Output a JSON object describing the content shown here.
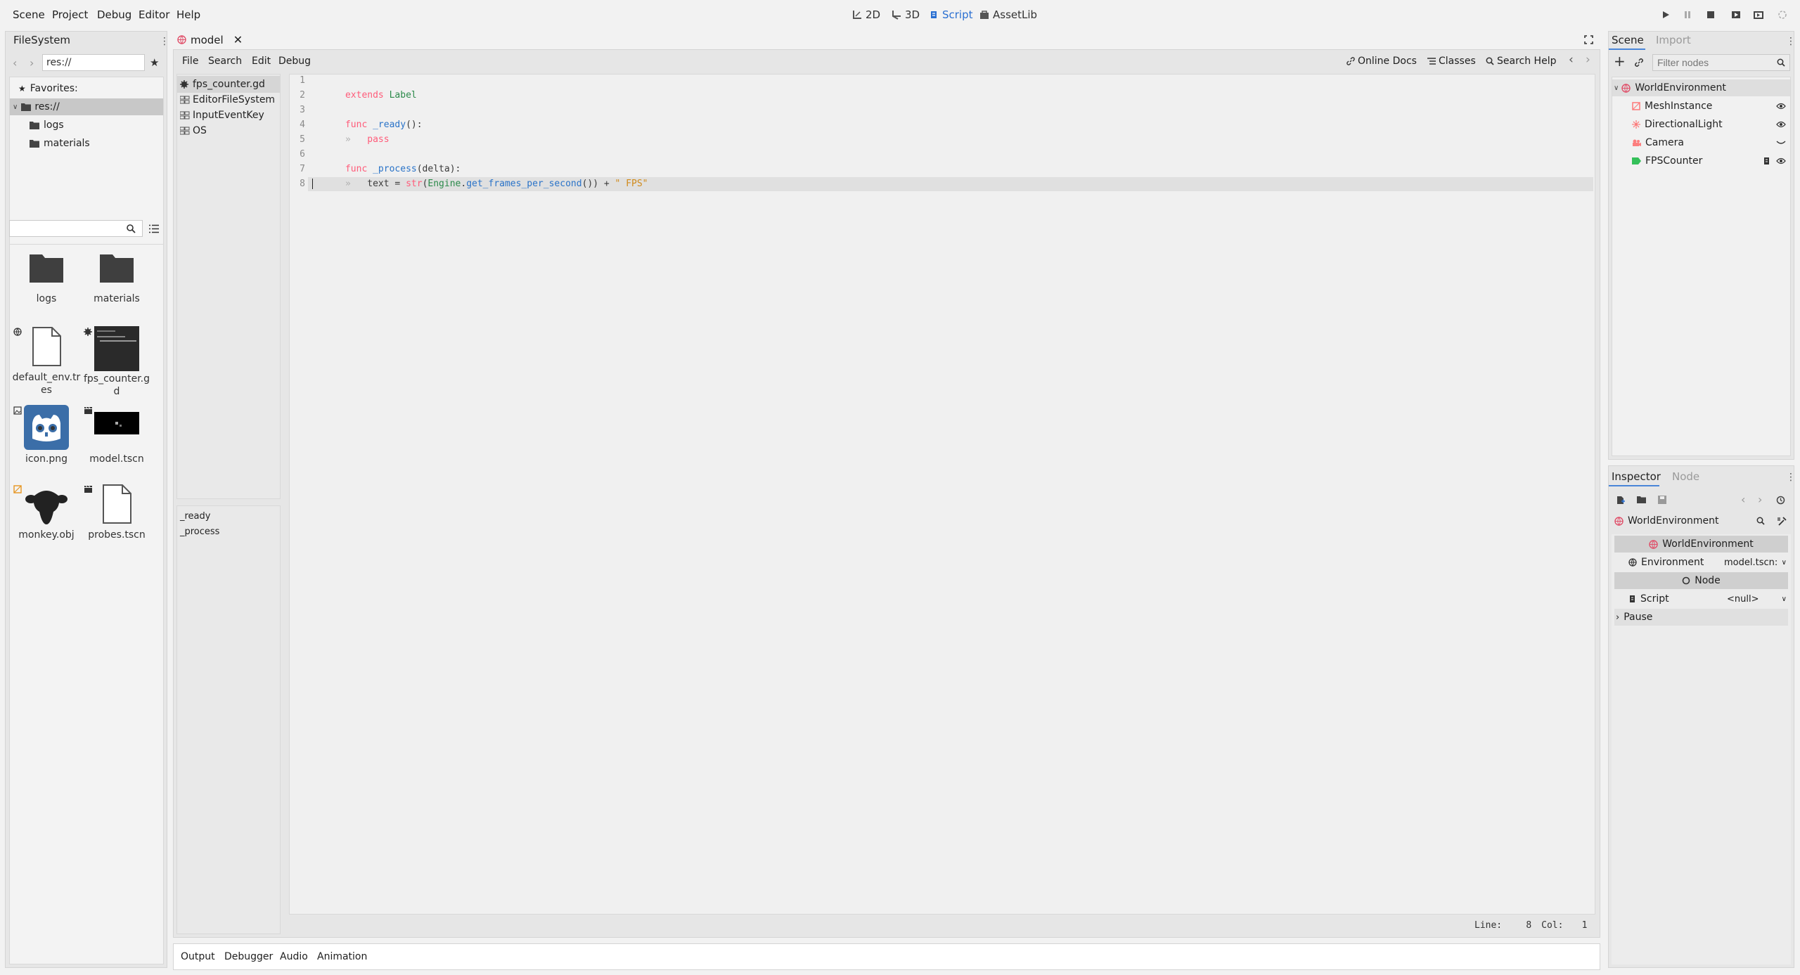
{
  "menu": [
    "Scene",
    "Project",
    "Debug",
    "Editor",
    "Help"
  ],
  "modes": [
    {
      "label": "2D",
      "icon": "2d-icon",
      "active": false
    },
    {
      "label": "3D",
      "icon": "3d-icon",
      "active": false
    },
    {
      "label": "Script",
      "icon": "script-icon",
      "active": true
    },
    {
      "label": "AssetLib",
      "icon": "assetlib-icon",
      "active": false
    }
  ],
  "filesystem": {
    "tab": "FileSystem",
    "path": "res://",
    "favorites": "Favorites:",
    "tree": [
      "res://",
      "logs",
      "materials"
    ],
    "search_placeholder": "",
    "files": [
      {
        "name": "logs",
        "type": "folder"
      },
      {
        "name": "materials",
        "type": "folder"
      },
      {
        "name": "default_env.tres",
        "type": "resource"
      },
      {
        "name": "fps_counter.gd",
        "type": "script"
      },
      {
        "name": "icon.png",
        "type": "image"
      },
      {
        "name": "model.tscn",
        "type": "scene"
      },
      {
        "name": "monkey.obj",
        "type": "mesh"
      },
      {
        "name": "probes.tscn",
        "type": "scene"
      }
    ]
  },
  "scene_tab": {
    "label": "model"
  },
  "script_editor": {
    "menu": [
      "File",
      "Search",
      "Edit",
      "Debug"
    ],
    "help_buttons": [
      "Online Docs",
      "Classes",
      "Search Help"
    ],
    "scripts": [
      "fps_counter.gd",
      "EditorFileSystem",
      "InputEventKey",
      "OS"
    ],
    "methods": [
      "_ready",
      "_process"
    ],
    "line_numbers": [
      "1",
      "2",
      "3",
      "4",
      "5",
      "6",
      "7",
      "8"
    ],
    "code": {
      "l1a": "extends",
      "l1b": " Label",
      "l3a": "func",
      "l3b": " _ready",
      "l3c": "():",
      "l4a": "pass",
      "l6a": "func",
      "l6b": " _process",
      "l6c": "(delta):",
      "l7a": "text = ",
      "l7b": "str",
      "l7c": "(",
      "l7d": "Engine",
      "l7e": ".",
      "l7f": "get_frames_per_second",
      "l7g": "()) + ",
      "l7h": "\" FPS\""
    },
    "status": {
      "line_label": "Line:",
      "line": "8",
      "col_label": "Col:",
      "col": "1"
    }
  },
  "bottom_tabs": [
    "Output",
    "Debugger",
    "Audio",
    "Animation"
  ],
  "scene_panel": {
    "tabs": [
      "Scene",
      "Import"
    ],
    "filter_placeholder": "Filter nodes",
    "nodes": [
      {
        "name": "WorldEnvironment",
        "icon": "world-environment-icon",
        "color": "#e0506a"
      },
      {
        "name": "MeshInstance",
        "icon": "mesh-instance-icon",
        "color": "#fc7f7f"
      },
      {
        "name": "DirectionalLight",
        "icon": "directional-light-icon",
        "color": "#fc7f7f"
      },
      {
        "name": "Camera",
        "icon": "camera-icon",
        "color": "#fc7f7f"
      },
      {
        "name": "FPSCounter",
        "icon": "label-icon",
        "color": "#35c05a"
      }
    ]
  },
  "inspector": {
    "tabs": [
      "Inspector",
      "Node"
    ],
    "object": "WorldEnvironment",
    "section1": "WorldEnvironment",
    "environment_label": "Environment",
    "environment_value": "model.tscn:",
    "section2": "Node",
    "script_label": "Script",
    "script_value": "<null>",
    "pause_label": "Pause"
  }
}
